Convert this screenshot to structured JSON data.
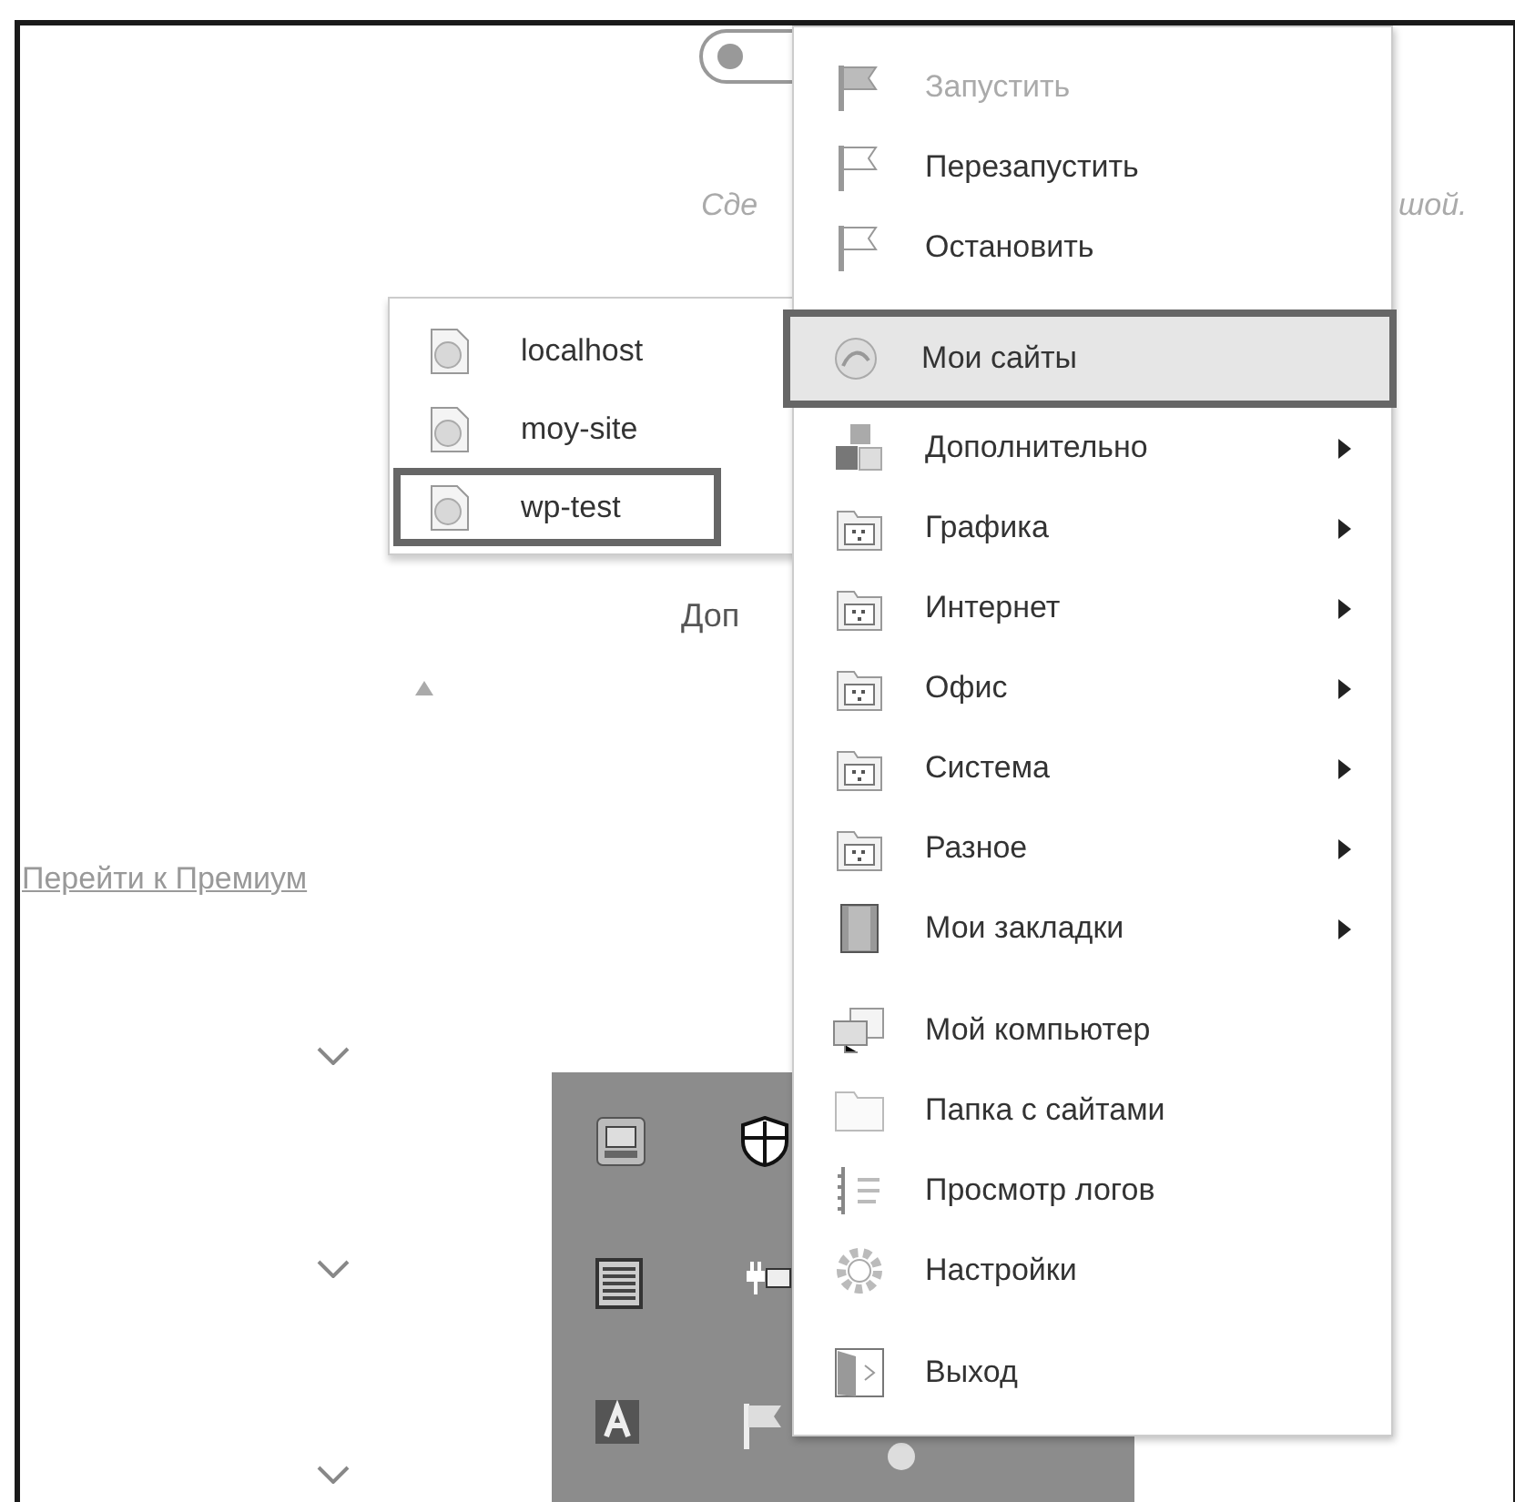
{
  "background": {
    "toggle": {
      "on": false
    },
    "caption_left": "Сде",
    "caption_right": "шой.",
    "heading_fragment": "Доп",
    "premium_link": "Перейти к Премиум"
  },
  "menu": {
    "items": [
      {
        "kind": "item",
        "label": "Запустить",
        "disabled": true,
        "selected": false,
        "submenu": false
      },
      {
        "kind": "item",
        "label": "Перезапустить",
        "disabled": false,
        "selected": false,
        "submenu": false
      },
      {
        "kind": "item",
        "label": "Остановить",
        "disabled": false,
        "selected": false,
        "submenu": false
      },
      {
        "kind": "separator"
      },
      {
        "kind": "item",
        "label": "Мои сайты",
        "disabled": false,
        "selected": true,
        "submenu": false
      },
      {
        "kind": "item",
        "label": "Дополнительно",
        "disabled": false,
        "selected": false,
        "submenu": true
      },
      {
        "kind": "item",
        "label": "Графика",
        "disabled": false,
        "selected": false,
        "submenu": true
      },
      {
        "kind": "item",
        "label": "Интернет",
        "disabled": false,
        "selected": false,
        "submenu": true
      },
      {
        "kind": "item",
        "label": "Офис",
        "disabled": false,
        "selected": false,
        "submenu": true
      },
      {
        "kind": "item",
        "label": "Система",
        "disabled": false,
        "selected": false,
        "submenu": true
      },
      {
        "kind": "item",
        "label": "Разное",
        "disabled": false,
        "selected": false,
        "submenu": true
      },
      {
        "kind": "item",
        "label": "Мои закладки",
        "disabled": false,
        "selected": false,
        "submenu": true
      },
      {
        "kind": "separator"
      },
      {
        "kind": "item",
        "label": "Мой компьютер",
        "disabled": false,
        "selected": false,
        "submenu": false
      },
      {
        "kind": "item",
        "label": "Папка с сайтами",
        "disabled": false,
        "selected": false,
        "submenu": false
      },
      {
        "kind": "item",
        "label": "Просмотр логов",
        "disabled": false,
        "selected": false,
        "submenu": false
      },
      {
        "kind": "item",
        "label": "Настройки",
        "disabled": false,
        "selected": false,
        "submenu": false
      },
      {
        "kind": "separator"
      },
      {
        "kind": "item",
        "label": "Выход",
        "disabled": false,
        "selected": false,
        "submenu": false
      }
    ]
  },
  "submenu": {
    "items": [
      {
        "label": "localhost",
        "selected": false
      },
      {
        "label": "moy-site",
        "selected": false
      },
      {
        "label": "wp-test",
        "selected": true
      }
    ]
  }
}
